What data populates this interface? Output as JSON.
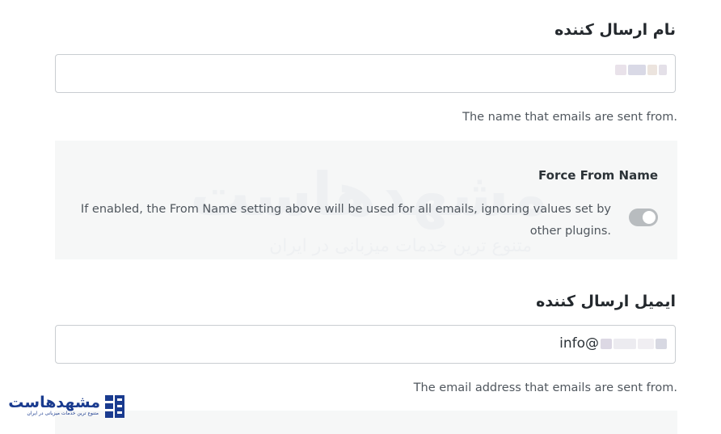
{
  "from_name": {
    "label": "نام ارسال کننده",
    "help": "The name that emails are sent from."
  },
  "force_from_name": {
    "title": "Force From Name",
    "description": "If enabled, the From Name setting above will be used for all emails, ignoring values set by other plugins.",
    "enabled": false
  },
  "from_email": {
    "label": "ایمیل ارسال کننده",
    "value_prefix": "info@",
    "help": "The email address that emails are sent from."
  },
  "watermark": {
    "brand": "مشهدهاست",
    "tagline": "متنوع ترین خدمات میزبانی در ایران"
  },
  "colors": {
    "brand": "#1a3b8f",
    "panel": "#f6f7f7",
    "toggle_off": "#b8bcbf"
  }
}
